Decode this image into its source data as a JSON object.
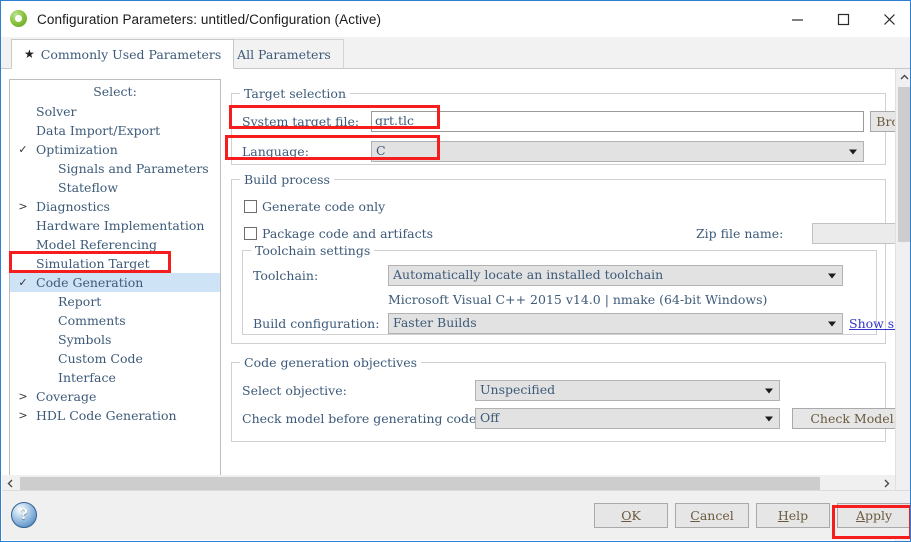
{
  "window": {
    "title": "Configuration Parameters: untitled/Configuration (Active)",
    "app_icon": "matlab-icon",
    "minimize_icon": "minimize-icon",
    "maximize_icon": "maximize-icon",
    "close_icon": "close-icon"
  },
  "tabs": [
    {
      "label": "Commonly Used Parameters",
      "icon": "star-icon",
      "glyph": "★",
      "active": true
    },
    {
      "label": "All Parameters",
      "icon": "list-icon",
      "glyph": "≡",
      "active": false
    }
  ],
  "sidebar": {
    "header": "Select:",
    "items": [
      {
        "label": "Solver",
        "indent": 1,
        "arrow": "",
        "selected": false
      },
      {
        "label": "Data Import/Export",
        "indent": 1,
        "arrow": "",
        "selected": false
      },
      {
        "label": "Optimization",
        "indent": 1,
        "arrow": "v",
        "selected": false
      },
      {
        "label": "Signals and Parameters",
        "indent": 2,
        "arrow": "",
        "selected": false
      },
      {
        "label": "Stateflow",
        "indent": 2,
        "arrow": "",
        "selected": false
      },
      {
        "label": "Diagnostics",
        "indent": 1,
        "arrow": ">",
        "selected": false
      },
      {
        "label": "Hardware Implementation",
        "indent": 1,
        "arrow": "",
        "selected": false
      },
      {
        "label": "Model Referencing",
        "indent": 1,
        "arrow": "",
        "selected": false
      },
      {
        "label": "Simulation Target",
        "indent": 1,
        "arrow": "",
        "selected": false
      },
      {
        "label": "Code Generation",
        "indent": 1,
        "arrow": "v",
        "selected": true
      },
      {
        "label": "Report",
        "indent": 2,
        "arrow": "",
        "selected": false
      },
      {
        "label": "Comments",
        "indent": 2,
        "arrow": "",
        "selected": false
      },
      {
        "label": "Symbols",
        "indent": 2,
        "arrow": "",
        "selected": false
      },
      {
        "label": "Custom Code",
        "indent": 2,
        "arrow": "",
        "selected": false
      },
      {
        "label": "Interface",
        "indent": 2,
        "arrow": "",
        "selected": false
      },
      {
        "label": "Coverage",
        "indent": 1,
        "arrow": ">",
        "selected": false
      },
      {
        "label": "HDL Code Generation",
        "indent": 1,
        "arrow": ">",
        "selected": false
      }
    ]
  },
  "target_selection": {
    "legend": "Target selection",
    "system_target_file_label": "System target file:",
    "system_target_file_value": "grt.tlc",
    "browse_label": "Brow",
    "language_label": "Language:",
    "language_value": "C"
  },
  "build_process": {
    "legend": "Build process",
    "generate_code_only_label": "Generate code only",
    "generate_code_only_checked": false,
    "package_code_label": "Package code and artifacts",
    "package_code_checked": false,
    "zip_file_name_label": "Zip file name:",
    "zip_file_name_value": "",
    "toolchain_settings": {
      "legend": "Toolchain settings",
      "toolchain_label": "Toolchain:",
      "toolchain_value": "Automatically locate an installed toolchain",
      "toolchain_detail": "Microsoft Visual C++ 2015 v14.0 | nmake (64-bit Windows)",
      "build_configuration_label": "Build configuration:",
      "build_configuration_value": "Faster Builds",
      "show_settings_label": "Show set"
    }
  },
  "code_generation_objectives": {
    "legend": "Code generation objectives",
    "select_objective_label": "Select objective:",
    "select_objective_value": "Unspecified",
    "check_model_label": "Check model before generating code:",
    "check_model_value": "Off",
    "check_model_button": "Check Model."
  },
  "footer": {
    "help_icon": "help-icon",
    "buttons": [
      {
        "name": "ok-button",
        "pre": "",
        "mnemonic": "O",
        "post": "K"
      },
      {
        "name": "cancel-button",
        "pre": "",
        "mnemonic": "C",
        "post": "ancel"
      },
      {
        "name": "help-button",
        "pre": "",
        "mnemonic": "H",
        "post": "elp"
      },
      {
        "name": "apply-button",
        "pre": "",
        "mnemonic": "A",
        "post": "pply"
      }
    ]
  },
  "scrollbars": {
    "v_up_icon": "chevron-up-icon",
    "v_down_icon": "chevron-down-icon",
    "h_left_icon": "chevron-left-icon",
    "h_right_icon": "chevron-right-icon"
  },
  "annotations": {
    "highlight_color": "#f51d1d",
    "boxes": [
      "system-target-file-highlight",
      "language-highlight",
      "code-generation-node-highlight",
      "apply-button-highlight"
    ]
  }
}
